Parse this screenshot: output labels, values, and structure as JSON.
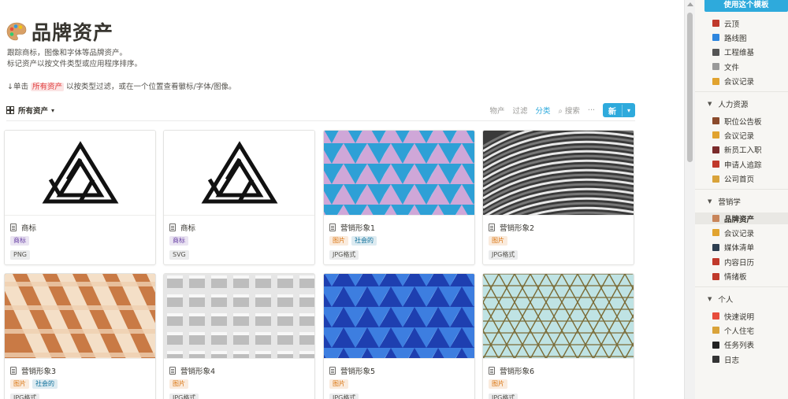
{
  "page": {
    "title": "品牌资产",
    "description_line1": "跟踪商标，图像和字体等品牌资产。",
    "description_line2": "标记资产以按文件类型或应用程序排序。",
    "hint_prefix": "↓单击",
    "hint_mention": "所有资产",
    "hint_suffix": "以按类型过滤，或在一个位置查看徽标/字体/图像。"
  },
  "view": {
    "name": "所有资产",
    "actions": {
      "property": "物产",
      "filter": "过滤",
      "sort": "分类",
      "search": "搜索",
      "more": "···"
    },
    "new_label": "新"
  },
  "cards": [
    {
      "name": "商标",
      "tags": [
        {
          "text": "商标",
          "color": "purple"
        }
      ],
      "format": "PNG",
      "cover": "logo"
    },
    {
      "name": "商标",
      "tags": [
        {
          "text": "商标",
          "color": "purple"
        }
      ],
      "format": "SVG",
      "cover": "logo"
    },
    {
      "name": "营销形象1",
      "tags": [
        {
          "text": "图片",
          "color": "orange"
        },
        {
          "text": "社会的",
          "color": "blue"
        }
      ],
      "format": "JPG格式",
      "cover": "triangles-pink"
    },
    {
      "name": "营销形象2",
      "tags": [
        {
          "text": "图片",
          "color": "orange"
        }
      ],
      "format": "JPG格式",
      "cover": "waves-gray"
    },
    {
      "name": "营销形象3",
      "tags": [
        {
          "text": "图片",
          "color": "orange"
        },
        {
          "text": "社会的",
          "color": "blue"
        }
      ],
      "format": "JPG格式",
      "cover": "building-orange"
    },
    {
      "name": "营销形象4",
      "tags": [
        {
          "text": "图片",
          "color": "orange"
        }
      ],
      "format": "JPG格式",
      "cover": "grid-white"
    },
    {
      "name": "营销形象5",
      "tags": [
        {
          "text": "图片",
          "color": "orange"
        }
      ],
      "format": "JPG格式",
      "cover": "triangles-blue"
    },
    {
      "name": "营销形象6",
      "tags": [
        {
          "text": "图片",
          "color": "orange"
        }
      ],
      "format": "JPG格式",
      "cover": "dome-teal"
    }
  ],
  "sidebar": {
    "use_template": "使用这个模板",
    "group1_items": [
      {
        "label": "云顶",
        "icon": "cloud-icon",
        "color": "#c0392b"
      },
      {
        "label": "路线图",
        "icon": "map-icon",
        "color": "#2e86de"
      },
      {
        "label": "工程维基",
        "icon": "book-icon",
        "color": "#555"
      },
      {
        "label": "文件",
        "icon": "paperclip-icon",
        "color": "#999"
      },
      {
        "label": "会议记录",
        "icon": "pencil-icon",
        "color": "#e1a32f"
      }
    ],
    "sections": [
      {
        "title": "人力资源",
        "items": [
          {
            "label": "职位公告板",
            "icon": "briefcase-icon",
            "color": "#8b4a2b"
          },
          {
            "label": "会议记录",
            "icon": "pencil-icon",
            "color": "#e1a32f"
          },
          {
            "label": "新员工入职",
            "icon": "people-icon",
            "color": "#7a2b2b"
          },
          {
            "label": "申请人追踪",
            "icon": "badge-icon",
            "color": "#c0392b"
          },
          {
            "label": "公司首页",
            "icon": "house-icon",
            "color": "#d9a33a"
          }
        ]
      },
      {
        "title": "营销学",
        "items": [
          {
            "label": "品牌资产",
            "icon": "palette-icon",
            "color": "#c8855a"
          },
          {
            "label": "会议记录",
            "icon": "pencil-icon",
            "color": "#e1a32f"
          },
          {
            "label": "媒体清单",
            "icon": "megaphone-icon",
            "color": "#2d3e50"
          },
          {
            "label": "内容日历",
            "icon": "calendar-icon",
            "color": "#c0392b"
          },
          {
            "label": "情绪板",
            "icon": "frame-icon",
            "color": "#c0392b"
          }
        ]
      },
      {
        "title": "个人",
        "items": [
          {
            "label": "快速说明",
            "icon": "pin-icon",
            "color": "#e74c3c"
          },
          {
            "label": "个人住宅",
            "icon": "house-icon",
            "color": "#d9a33a"
          },
          {
            "label": "任务列表",
            "icon": "check-icon",
            "color": "#222"
          },
          {
            "label": "日志",
            "icon": "pen-icon",
            "color": "#333"
          }
        ]
      }
    ]
  }
}
